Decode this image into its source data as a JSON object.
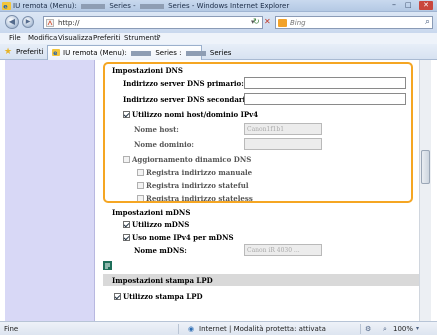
{
  "window": {
    "title_prefix": "IU remota (Menu):",
    "title_mid": "Series -",
    "title_suffix": "Series - Windows Internet Explorer"
  },
  "address": {
    "url": "http://",
    "search_placeholder": "Bing"
  },
  "menu": {
    "items": [
      "File",
      "Modifica",
      "Visualizza",
      "Preferiti",
      "Strumenti",
      "?"
    ]
  },
  "favorites": {
    "label": "Preferiti",
    "tab_prefix": "IU remota (Menu):",
    "tab_mid": "Series :",
    "tab_suffix": "Series"
  },
  "dns": {
    "header": "Impostazioni DNS",
    "primary_label": "Indirizzo server DNS primario:",
    "primary_value": "",
    "secondary_label": "Indirizzo server DNS secondario:",
    "secondary_value": "",
    "use_names_label": "Utilizzo nomi host/dominio IPv4",
    "use_names_checked": true,
    "host_label": "Nome host:",
    "host_value": "Canon1f1b1",
    "domain_label": "Nome dominio:",
    "domain_value": "",
    "dynamic_label": "Aggiornamento dinamico DNS",
    "dynamic_checked": false,
    "manual_label": "Registra indirizzo manuale",
    "stateful_label": "Registra indirizzo stateful",
    "stateless_label": "Registra indirizzo stateless"
  },
  "mdns": {
    "header": "Impostazioni mDNS",
    "use_label": "Utilizzo mDNS",
    "use_checked": true,
    "ipv4_label": "Uso nome IPv4 per mDNS",
    "ipv4_checked": true,
    "name_label": "Nome mDNS:",
    "name_value": "Canon iR 4030 ..."
  },
  "lpd": {
    "header": "Impostazioni stampa LPD",
    "use_label": "Utilizzo stampa LPD",
    "use_checked": true
  },
  "status": {
    "left": "Fine",
    "zone": "Internet | Modalità protetta: attivata",
    "zoom": "100%"
  },
  "colors": {
    "highlight": "#f5a623",
    "leftnav": "#d8d8f6",
    "section_header": "#d9d9d9"
  }
}
